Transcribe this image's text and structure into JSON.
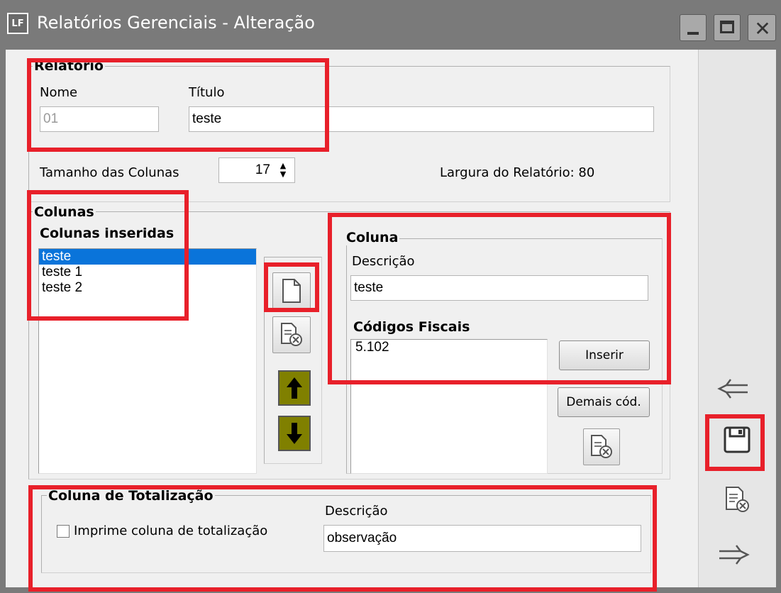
{
  "window": {
    "title": "Relatórios Gerenciais - Alteração",
    "app_icon": "LF"
  },
  "relatorio": {
    "group_title": "Relatorio",
    "nome_label": "Nome",
    "nome_value": "01",
    "titulo_label": "Título",
    "titulo_value": "teste",
    "tamanho_label": "Tamanho das Colunas",
    "tamanho_value": "17",
    "largura_text": "Largura do Relatório: 80"
  },
  "colunas": {
    "group_title": "Colunas",
    "inseridas_title": "Colunas inseridas",
    "items": [
      "teste",
      "teste 1",
      "teste 2"
    ],
    "selected_index": 0
  },
  "coluna": {
    "group_title": "Coluna",
    "descricao_label": "Descrição",
    "descricao_value": "teste",
    "codigos_title": "Códigos Fiscais",
    "codigos_items": [
      "5.102"
    ],
    "inserir_label": "Inserir",
    "demais_label": "Demais cód."
  },
  "totalizacao": {
    "group_title": "Coluna de Totalização",
    "checkbox_label": "Imprime coluna de totalização",
    "checkbox_checked": false,
    "descricao_label": "Descrição",
    "descricao_value": "observação"
  },
  "icons": {
    "new": "new-document-icon",
    "delete": "delete-document-icon",
    "up": "arrow-up-icon",
    "down": "arrow-down-icon",
    "back": "back-arrow-icon",
    "save": "save-icon",
    "cancel": "cancel-document-icon",
    "forward": "forward-arrow-icon"
  },
  "colors": {
    "highlight": "#e8202a",
    "selection": "#0a74da",
    "arrow_button": "#808000",
    "titlebar": "#7a7a7a"
  }
}
